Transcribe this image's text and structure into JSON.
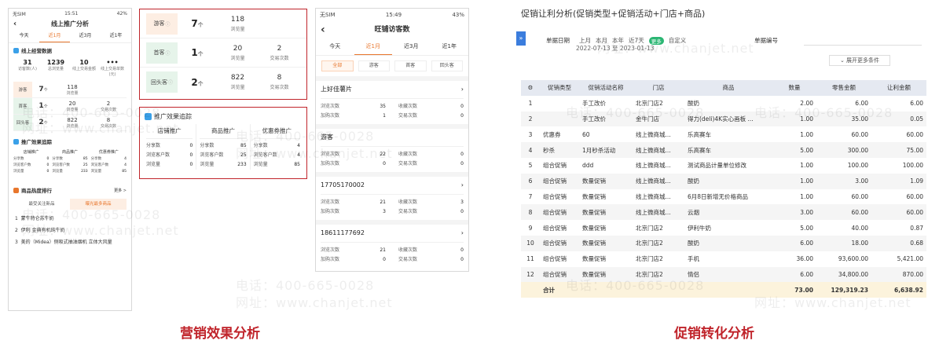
{
  "left_phone": {
    "status": {
      "carrier": "无SIM",
      "time": "15:51",
      "battery": "42%"
    },
    "title": "线上推广分析",
    "tabs": [
      "今天",
      "近1月",
      "近3月",
      "近1年"
    ],
    "active_tab": "近1月",
    "section_data": "线上经营数据",
    "stats": [
      {
        "value": "31",
        "label": "访客数(人)"
      },
      {
        "value": "1239",
        "label": "总浏览量"
      },
      {
        "value": "10",
        "label": "线上交易金额"
      },
      {
        "value": "•••",
        "label": "线上交易单数(元)"
      }
    ],
    "funnel": [
      {
        "label": "游客",
        "count": "7",
        "unit": "个",
        "v1": "118",
        "l1": "浏览量",
        "v2": "",
        "l2": ""
      },
      {
        "label": "首客",
        "count": "1",
        "unit": "个",
        "v1": "20",
        "l1": "浏览量",
        "v2": "2",
        "l2": "交易次数"
      },
      {
        "label": "回头客",
        "count": "2",
        "unit": "个",
        "v1": "822",
        "l1": "浏览量",
        "v2": "8",
        "l2": "交易次数"
      }
    ],
    "section_promo": "推广效果追踪",
    "promo_cols": [
      {
        "title": "店铺推广",
        "rows": [
          [
            "分享数",
            "0"
          ],
          [
            "浏览客户数",
            "0"
          ],
          [
            "浏览量",
            "0"
          ]
        ]
      },
      {
        "title": "商品推广",
        "rows": [
          [
            "分享数",
            "85"
          ],
          [
            "浏览客户数",
            "25"
          ],
          [
            "浏览量",
            "233"
          ]
        ]
      },
      {
        "title": "优惠券推广",
        "rows": [
          [
            "分享数",
            "4"
          ],
          [
            "浏览客户数",
            "4"
          ],
          [
            "浏览量",
            "85"
          ]
        ]
      }
    ],
    "section_hot": "商品热度排行",
    "more": "更多 >",
    "hot_tabs": [
      "最受关注新品",
      "曝光最多商品"
    ],
    "hot_list": [
      {
        "rank": "1",
        "name": "蒙牛特仑苏牛奶"
      },
      {
        "rank": "2",
        "name": "伊利 金典有机纯牛奶"
      },
      {
        "rank": "3",
        "name": "美的（Midea）侧吸式抽油烟机 立体大风量"
      }
    ]
  },
  "mid_panel_funnel": [
    {
      "label": "游客",
      "count": "7",
      "unit": "个",
      "v1": "118",
      "l1": "浏览量",
      "v2": "",
      "l2": ""
    },
    {
      "label": "首客",
      "count": "1",
      "unit": "个",
      "v1": "20",
      "l1": "浏览量",
      "v2": "2",
      "l2": "交易次数"
    },
    {
      "label": "回头客",
      "count": "2",
      "unit": "个",
      "v1": "822",
      "l1": "浏览量",
      "v2": "8",
      "l2": "交易次数"
    }
  ],
  "mid_panel_promo": {
    "title": "推广效果追踪",
    "cols": [
      {
        "title": "店铺推广",
        "rows": [
          [
            "分享数",
            "0"
          ],
          [
            "浏览客户数",
            "0"
          ],
          [
            "浏览量",
            "0"
          ]
        ]
      },
      {
        "title": "商品推广",
        "rows": [
          [
            "分享数",
            "85"
          ],
          [
            "浏览客户数",
            "25"
          ],
          [
            "浏览量",
            "233"
          ]
        ]
      },
      {
        "title": "优惠券推广",
        "rows": [
          [
            "分享数",
            "4"
          ],
          [
            "浏览客户数",
            "4"
          ],
          [
            "浏览量",
            "85"
          ]
        ]
      }
    ]
  },
  "right_phone": {
    "status": {
      "carrier": "无SIM",
      "time": "15:49",
      "battery": "43%"
    },
    "title": "旺铺访客数",
    "tabs": [
      "今天",
      "近1月",
      "近3月",
      "近1年"
    ],
    "active_tab": "近1月",
    "filters": [
      "全部",
      "游客",
      "首客",
      "回头客"
    ],
    "active_filter": "全部",
    "visitors": [
      {
        "name": "上好佳薯片",
        "a": [
          "浏览次数",
          "35"
        ],
        "b": [
          "收藏次数",
          "0"
        ],
        "c": [
          "加购次数",
          "1"
        ],
        "d": [
          "交易次数",
          "0"
        ]
      },
      {
        "name": "游客",
        "a": [
          "浏览次数",
          "22"
        ],
        "b": [
          "收藏次数",
          "0"
        ],
        "c": [
          "加购次数",
          "0"
        ],
        "d": [
          "交易次数",
          "0"
        ]
      },
      {
        "name": "17705170002",
        "a": [
          "浏览次数",
          "21"
        ],
        "b": [
          "收藏次数",
          "3"
        ],
        "c": [
          "加购次数",
          "3"
        ],
        "d": [
          "交易次数",
          "0"
        ]
      },
      {
        "name": "18611177692",
        "a": [
          "浏览次数",
          "21"
        ],
        "b": [
          "收藏次数",
          "0"
        ],
        "c": [
          "加购次数",
          "0"
        ],
        "d": [
          "交易次数",
          "0"
        ]
      }
    ]
  },
  "report": {
    "title": "促销让利分析(促销类型+促销活动+门店+商品)",
    "date_label": "单据日期",
    "date_quick": [
      "上月",
      "本月",
      "本年",
      "近7天"
    ],
    "date_more": "更多",
    "custom": "自定义",
    "date_range": "2022-07-13 至 2023-01-13",
    "doc_no_label": "单据编号",
    "expand": "展开更多条件",
    "columns": [
      "促销类型",
      "促销活动名称",
      "门店",
      "商品",
      "数量",
      "零售金额",
      "让利金额"
    ],
    "rows": [
      [
        "1",
        "",
        "手工改价",
        "北京门店2",
        "酸奶",
        "2.00",
        "6.00",
        "6.00"
      ],
      [
        "2",
        "",
        "手工改价",
        "金牛门店",
        "得力(deli)4K实心画板 ...",
        "1.00",
        "35.00",
        "0.05"
      ],
      [
        "3",
        "优惠券",
        "60",
        "线上微商城...",
        "乐高赛车",
        "1.00",
        "60.00",
        "60.00"
      ],
      [
        "4",
        "秒杀",
        "1月秒杀活动",
        "线上微商城...",
        "乐高赛车",
        "5.00",
        "300.00",
        "75.00"
      ],
      [
        "5",
        "组合促销",
        "ddd",
        "线上微商城...",
        "测试商品计量单位修改",
        "1.00",
        "100.00",
        "100.00"
      ],
      [
        "6",
        "组合促销",
        "数量促销",
        "线上微商城...",
        "酸奶",
        "1.00",
        "3.00",
        "1.09"
      ],
      [
        "7",
        "组合促销",
        "数量促销",
        "线上微商城...",
        "6月8日新增无价格商品",
        "1.00",
        "60.00",
        "60.00"
      ],
      [
        "8",
        "组合促销",
        "数量促销",
        "线上微商城...",
        "云烟",
        "3.00",
        "60.00",
        "60.00"
      ],
      [
        "9",
        "组合促销",
        "数量促销",
        "北京门店2",
        "伊利牛奶",
        "5.00",
        "40.00",
        "0.87"
      ],
      [
        "10",
        "组合促销",
        "数量促销",
        "北京门店2",
        "酸奶",
        "6.00",
        "18.00",
        "0.68"
      ],
      [
        "11",
        "组合促销",
        "数量促销",
        "北京门店2",
        "手机",
        "36.00",
        "93,600.00",
        "5,421.00"
      ],
      [
        "12",
        "组合促销",
        "数量促销",
        "北京门店2",
        "情侣",
        "6.00",
        "34,800.00",
        "870.00"
      ]
    ],
    "total": {
      "label": "合计",
      "qty": "73.00",
      "retail": "129,319.23",
      "discount": "6,638.92"
    }
  },
  "captions": {
    "left": "营销效果分析",
    "right": "促销转化分析"
  },
  "watermark": {
    "phone": "电话：400-665-0028",
    "site": "网址：www.chanjet.net"
  },
  "colors": {
    "accent": "#c0242b",
    "orange": "#e8762c",
    "green": "#2bb673"
  }
}
